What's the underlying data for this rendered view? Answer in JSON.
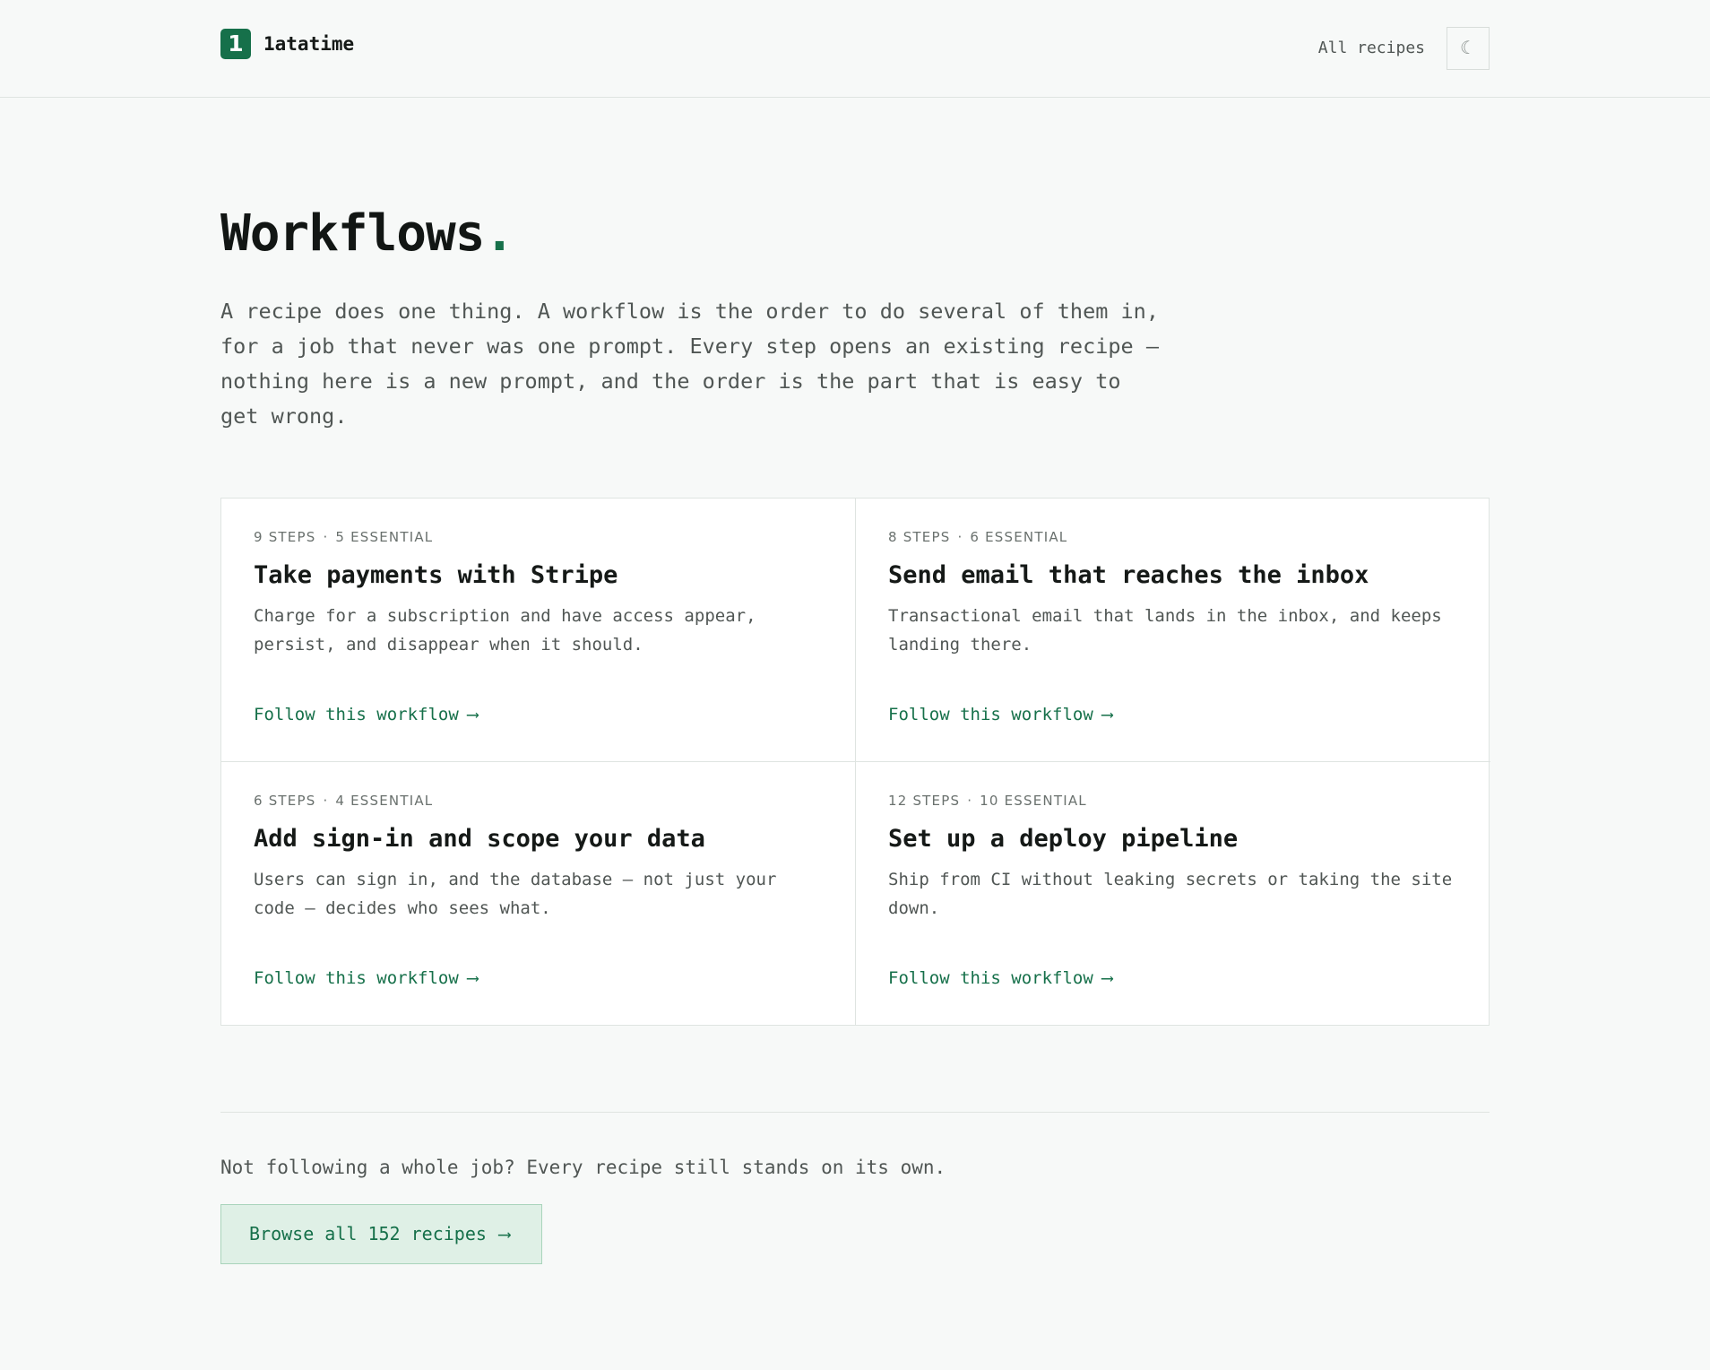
{
  "header": {
    "brand_mark": "1",
    "brand_name": "1atatime",
    "nav_link": "All recipes",
    "theme_toggle_glyph": "☾"
  },
  "hero": {
    "title": "Workflows",
    "title_dot": ".",
    "intro": "A recipe does one thing. A workflow is the order to do several of them in, for a job that never was one prompt. Every step opens an existing recipe — nothing here is a new prompt, and the order is the part that is easy to get wrong."
  },
  "workflows": [
    {
      "steps": "9 STEPS",
      "essential": "5 ESSENTIAL",
      "title": "Take payments with Stripe",
      "description": "Charge for a subscription and have access appear, persist, and disappear when it should.",
      "link": "Follow this workflow"
    },
    {
      "steps": "8 STEPS",
      "essential": "6 ESSENTIAL",
      "title": "Send email that reaches the inbox",
      "description": "Transactional email that lands in the inbox, and keeps landing there.",
      "link": "Follow this workflow"
    },
    {
      "steps": "6 STEPS",
      "essential": "4 ESSENTIAL",
      "title": "Add sign-in and scope your data",
      "description": "Users can sign in, and the database — not just your code — decides who sees what.",
      "link": "Follow this workflow"
    },
    {
      "steps": "12 STEPS",
      "essential": "10 ESSENTIAL",
      "title": "Set up a deploy pipeline",
      "description": "Ship from CI without leaking secrets or taking the site down.",
      "link": "Follow this workflow"
    }
  ],
  "meta_separator": "·",
  "arrow_glyph": "⟶",
  "footer": {
    "note": "Not following a whole job? Every recipe still stands on its own.",
    "browse_label": "Browse all 152 recipes"
  },
  "colors": {
    "accent": "#16704a",
    "background": "#f7f9f8",
    "button_bg": "#dff0e6"
  }
}
